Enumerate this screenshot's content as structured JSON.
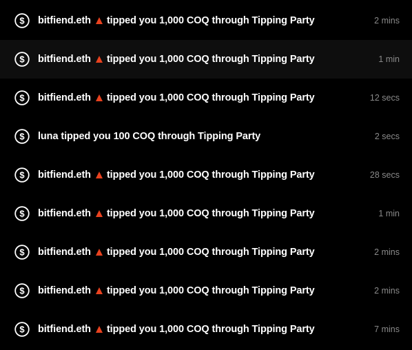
{
  "colors": {
    "background": "#000000",
    "row_highlight": "#0e0e0e",
    "text": "#ffffff",
    "time_text": "#8a8a8a",
    "badge": "#e8421f"
  },
  "notifications": [
    {
      "user": "bitfiend.eth",
      "badge": "red-triangle-icon",
      "text": "tipped you 1,000 COQ through Tipping Party",
      "time": "2 mins"
    },
    {
      "user": "bitfiend.eth",
      "badge": "red-triangle-icon",
      "text": "tipped you 1,000 COQ through Tipping Party",
      "time": "1 min"
    },
    {
      "user": "bitfiend.eth",
      "badge": "red-triangle-icon",
      "text": "tipped you 1,000 COQ through Tipping Party",
      "time": "12 secs"
    },
    {
      "user": "luna",
      "badge": "",
      "text": "tipped you 100 COQ through Tipping Party",
      "time": "2 secs"
    },
    {
      "user": "bitfiend.eth",
      "badge": "red-triangle-icon",
      "text": "tipped you 1,000 COQ through Tipping Party",
      "time": "28 secs"
    },
    {
      "user": "bitfiend.eth",
      "badge": "red-triangle-icon",
      "text": "tipped you 1,000 COQ through Tipping Party",
      "time": "1 min"
    },
    {
      "user": "bitfiend.eth",
      "badge": "red-triangle-icon",
      "text": "tipped you 1,000 COQ through Tipping Party",
      "time": "2 mins"
    },
    {
      "user": "bitfiend.eth",
      "badge": "red-triangle-icon",
      "text": "tipped you 1,000 COQ through Tipping Party",
      "time": "2 mins"
    },
    {
      "user": "bitfiend.eth",
      "badge": "red-triangle-icon",
      "text": "tipped you 1,000 COQ through Tipping Party",
      "time": "7 mins"
    }
  ]
}
